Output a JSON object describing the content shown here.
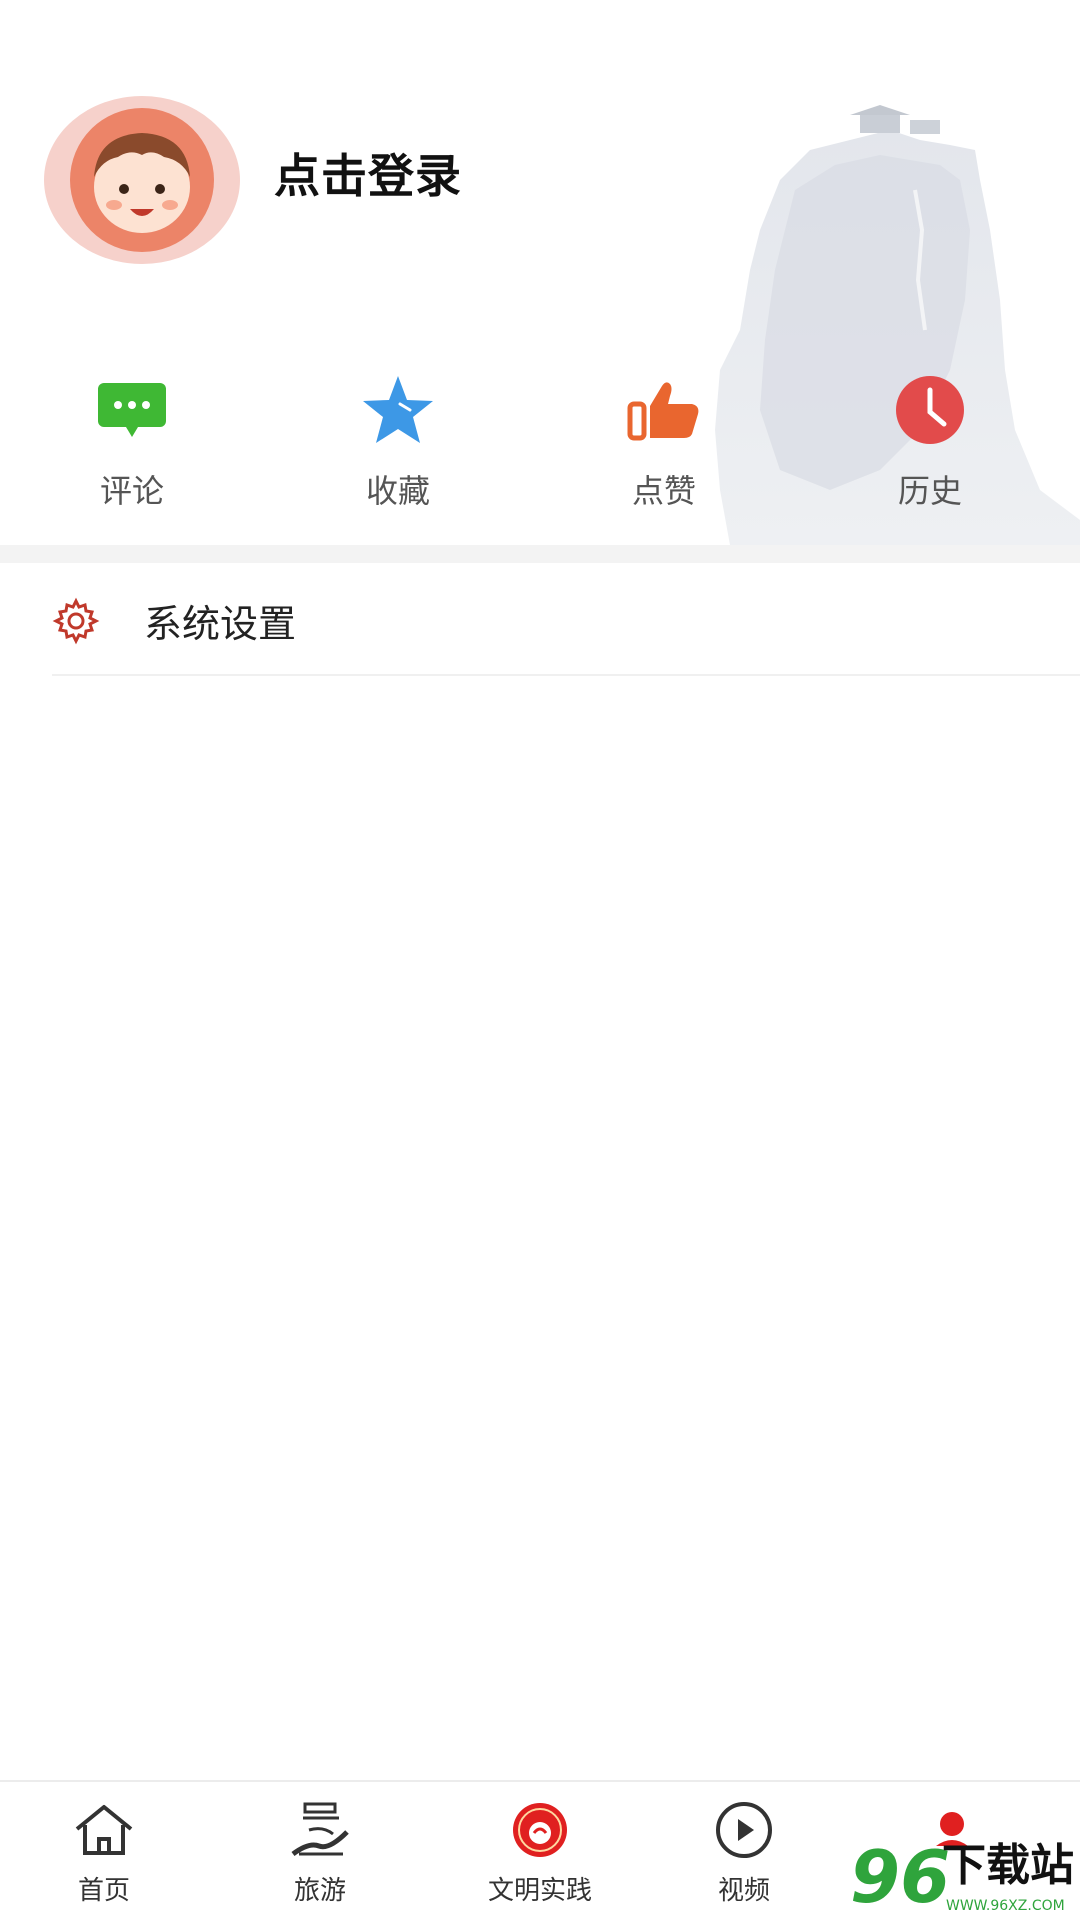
{
  "header": {
    "login_text": "点击登录"
  },
  "quick_actions": [
    {
      "label": "评论",
      "icon": "comment-icon",
      "color": "#3fb834"
    },
    {
      "label": "收藏",
      "icon": "star-icon",
      "color": "#3d98e6"
    },
    {
      "label": "点赞",
      "icon": "thumbs-up-icon",
      "color": "#e9662f"
    },
    {
      "label": "历史",
      "icon": "clock-icon",
      "color": "#e24b4b"
    }
  ],
  "settings": {
    "label": "系统设置",
    "icon": "gear-icon",
    "icon_color": "#c0392b"
  },
  "bottom_nav": [
    {
      "label": "首页",
      "icon": "home-icon"
    },
    {
      "label": "旅游",
      "icon": "travel-icon"
    },
    {
      "label": "文明实践",
      "icon": "civilization-badge-icon"
    },
    {
      "label": "视频",
      "icon": "video-play-icon"
    }
  ],
  "watermark": {
    "text": "下载站",
    "number": "96",
    "url": "WWW.96XZ.COM"
  }
}
